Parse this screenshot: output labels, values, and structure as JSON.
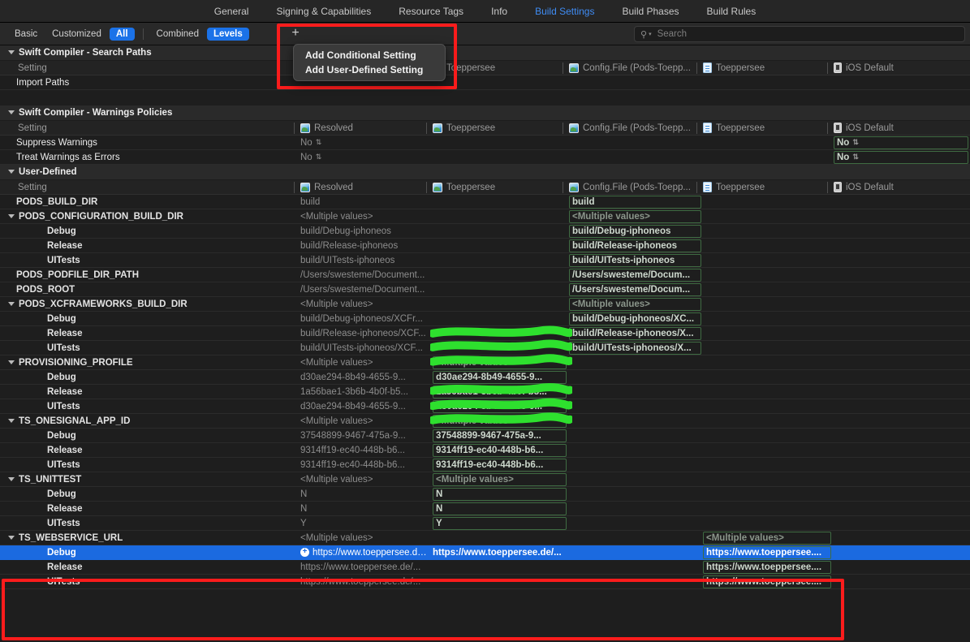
{
  "tabs": [
    {
      "label": "General",
      "active": false
    },
    {
      "label": "Signing & Capabilities",
      "active": false
    },
    {
      "label": "Resource Tags",
      "active": false
    },
    {
      "label": "Info",
      "active": false
    },
    {
      "label": "Build Settings",
      "active": true
    },
    {
      "label": "Build Phases",
      "active": false
    },
    {
      "label": "Build Rules",
      "active": false
    }
  ],
  "toolbar": {
    "filters": [
      {
        "label": "Basic",
        "on": false
      },
      {
        "label": "Customized",
        "on": false
      },
      {
        "label": "All",
        "on": true
      }
    ],
    "modes": [
      {
        "label": "Combined",
        "on": false
      },
      {
        "label": "Levels",
        "on": true
      }
    ],
    "add_button": "+",
    "search_placeholder": "Search",
    "search_value": "",
    "search_icon": "Q"
  },
  "menu": {
    "items": [
      {
        "label": "Add Conditional Setting"
      },
      {
        "label": "Add User-Defined Setting"
      }
    ]
  },
  "columns": [
    {
      "label": "Resolved",
      "icon": "project-icon"
    },
    {
      "label": "Toeppersee",
      "icon": "project-icon"
    },
    {
      "label": "Config.File (Pods-Toepp...",
      "icon": "project-icon"
    },
    {
      "label": "Toeppersee",
      "icon": "file-icon"
    },
    {
      "label": "iOS Default",
      "icon": "ios-icon"
    }
  ],
  "setting_header_label": "Setting",
  "sections": [
    {
      "title": "Swift Compiler - Search Paths",
      "rows": [
        {
          "name": "Import Paths",
          "indent": "plain",
          "values": [
            "",
            "",
            "",
            "",
            ""
          ]
        }
      ]
    },
    {
      "title": "Swift Compiler - Warnings Policies",
      "rows": [
        {
          "name": "Suppress Warnings",
          "indent": "plain",
          "values": [
            "No",
            "",
            "",
            "",
            "No"
          ],
          "stepper0": true,
          "box4": true,
          "stepper4": true
        },
        {
          "name": "Treat Warnings as Errors",
          "indent": "plain",
          "values": [
            "No",
            "",
            "",
            "",
            "No"
          ],
          "stepper0": true,
          "box4": true,
          "stepper4": true
        }
      ]
    },
    {
      "title": "User-Defined",
      "rows": [
        {
          "name": "PODS_BUILD_DIR",
          "indent": "top",
          "values": [
            "build",
            "",
            "build",
            "",
            ""
          ],
          "box2": true
        },
        {
          "name": "PODS_CONFIGURATION_BUILD_DIR",
          "indent": "top",
          "tri": true,
          "values": [
            "<Multiple values>",
            "",
            "<Multiple values>",
            "",
            ""
          ],
          "box2": true,
          "muted2": true
        },
        {
          "name": "Debug",
          "indent": "child",
          "values": [
            "build/Debug-iphoneos",
            "",
            "build/Debug-iphoneos",
            "",
            ""
          ],
          "box2": true
        },
        {
          "name": "Release",
          "indent": "child",
          "values": [
            "build/Release-iphoneos",
            "",
            "build/Release-iphoneos",
            "",
            ""
          ],
          "box2": true
        },
        {
          "name": "UITests",
          "indent": "child",
          "values": [
            "build/UITests-iphoneos",
            "",
            "build/UITests-iphoneos",
            "",
            ""
          ],
          "box2": true
        },
        {
          "name": "PODS_PODFILE_DIR_PATH",
          "indent": "top",
          "values": [
            "/Users/swesteme/Document...",
            "",
            "/Users/swesteme/Docum...",
            "",
            ""
          ],
          "box2": true
        },
        {
          "name": "PODS_ROOT",
          "indent": "top",
          "values": [
            "/Users/swesteme/Document...",
            "",
            "/Users/swesteme/Docum...",
            "",
            ""
          ],
          "box2": true
        },
        {
          "name": "PODS_XCFRAMEWORKS_BUILD_DIR",
          "indent": "top",
          "tri": true,
          "values": [
            "<Multiple values>",
            "",
            "<Multiple values>",
            "",
            ""
          ],
          "box2": true,
          "muted2": true
        },
        {
          "name": "Debug",
          "indent": "child",
          "values": [
            "build/Debug-iphoneos/XCFr...",
            "",
            "build/Debug-iphoneos/XC...",
            "",
            ""
          ],
          "box2": true
        },
        {
          "name": "Release",
          "indent": "child",
          "values": [
            "build/Release-iphoneos/XCF...",
            "",
            "build/Release-iphoneos/X...",
            "",
            ""
          ],
          "box2": true
        },
        {
          "name": "UITests",
          "indent": "child",
          "values": [
            "build/UITests-iphoneos/XCF...",
            "",
            "build/UITests-iphoneos/X...",
            "",
            ""
          ],
          "box2": true
        },
        {
          "name": "PROVISIONING_PROFILE",
          "indent": "top",
          "tri": true,
          "values": [
            "<Multiple values>",
            "<Multiple values>",
            "",
            "",
            ""
          ],
          "box1": true,
          "muted1": true
        },
        {
          "name": "Debug",
          "indent": "child",
          "values": [
            "d30ae294-8b49-4655-9...",
            "d30ae294-8b49-4655-9...",
            "",
            "",
            ""
          ],
          "box1": true,
          "redacted": true
        },
        {
          "name": "Release",
          "indent": "child",
          "values": [
            "1a56bae1-3b6b-4b0f-b5...",
            "1a56bae1-3b6b-4b0f-b5...",
            "",
            "",
            ""
          ],
          "box1": true,
          "redacted": true
        },
        {
          "name": "UITests",
          "indent": "child",
          "values": [
            "d30ae294-8b49-4655-9...",
            "d30ae294-8b49-4655-9...",
            "",
            "",
            ""
          ],
          "box1": true,
          "redacted": true
        },
        {
          "name": "TS_ONESIGNAL_APP_ID",
          "indent": "top",
          "tri": true,
          "values": [
            "<Multiple values>",
            "<Multiple values>",
            "",
            "",
            ""
          ],
          "box1": true,
          "muted1": true
        },
        {
          "name": "Debug",
          "indent": "child",
          "values": [
            "37548899-9467-475a-9...",
            "37548899-9467-475a-9...",
            "",
            "",
            ""
          ],
          "box1": true,
          "redacted": true
        },
        {
          "name": "Release",
          "indent": "child",
          "values": [
            "9314ff19-ec40-448b-b6...",
            "9314ff19-ec40-448b-b6...",
            "",
            "",
            ""
          ],
          "box1": true,
          "redacted": true
        },
        {
          "name": "UITests",
          "indent": "child",
          "values": [
            "9314ff19-ec40-448b-b6...",
            "9314ff19-ec40-448b-b6...",
            "",
            "",
            ""
          ],
          "box1": true,
          "redacted": true
        },
        {
          "name": "TS_UNITTEST",
          "indent": "top",
          "tri": true,
          "values": [
            "<Multiple values>",
            "<Multiple values>",
            "",
            "",
            ""
          ],
          "box1": true,
          "muted1": true
        },
        {
          "name": "Debug",
          "indent": "child",
          "values": [
            "N",
            "N",
            "",
            "",
            ""
          ],
          "box1": true
        },
        {
          "name": "Release",
          "indent": "child",
          "values": [
            "N",
            "N",
            "",
            "",
            ""
          ],
          "box1": true
        },
        {
          "name": "UITests",
          "indent": "child",
          "values": [
            "Y",
            "Y",
            "",
            "",
            ""
          ],
          "box1": true
        },
        {
          "name": "TS_WEBSERVICE_URL",
          "indent": "top",
          "tri": true,
          "values": [
            "<Multiple values>",
            "",
            "",
            "<Multiple values>",
            ""
          ],
          "box3": true,
          "muted3": true
        },
        {
          "name": "Debug",
          "indent": "child",
          "selected": true,
          "badge": true,
          "values": [
            "https://www.toeppersee.de/...",
            "https://www.toeppersee.de/...",
            "",
            "https://www.toeppersee....",
            ""
          ],
          "box3": true
        },
        {
          "name": "Release",
          "indent": "child",
          "values": [
            "https://www.toeppersee.de/...",
            "",
            "",
            "https://www.toeppersee....",
            ""
          ],
          "box3": true
        },
        {
          "name": "UITests",
          "indent": "child",
          "values": [
            "https://www.toeppersee.de/...",
            "",
            "",
            "https://www.toeppersee....",
            ""
          ],
          "box3": true
        }
      ]
    }
  ],
  "annotations": {
    "redact_color": "#2ee02e",
    "highlight_color": "#fb1c1c",
    "accent_color": "#1b72e8"
  }
}
